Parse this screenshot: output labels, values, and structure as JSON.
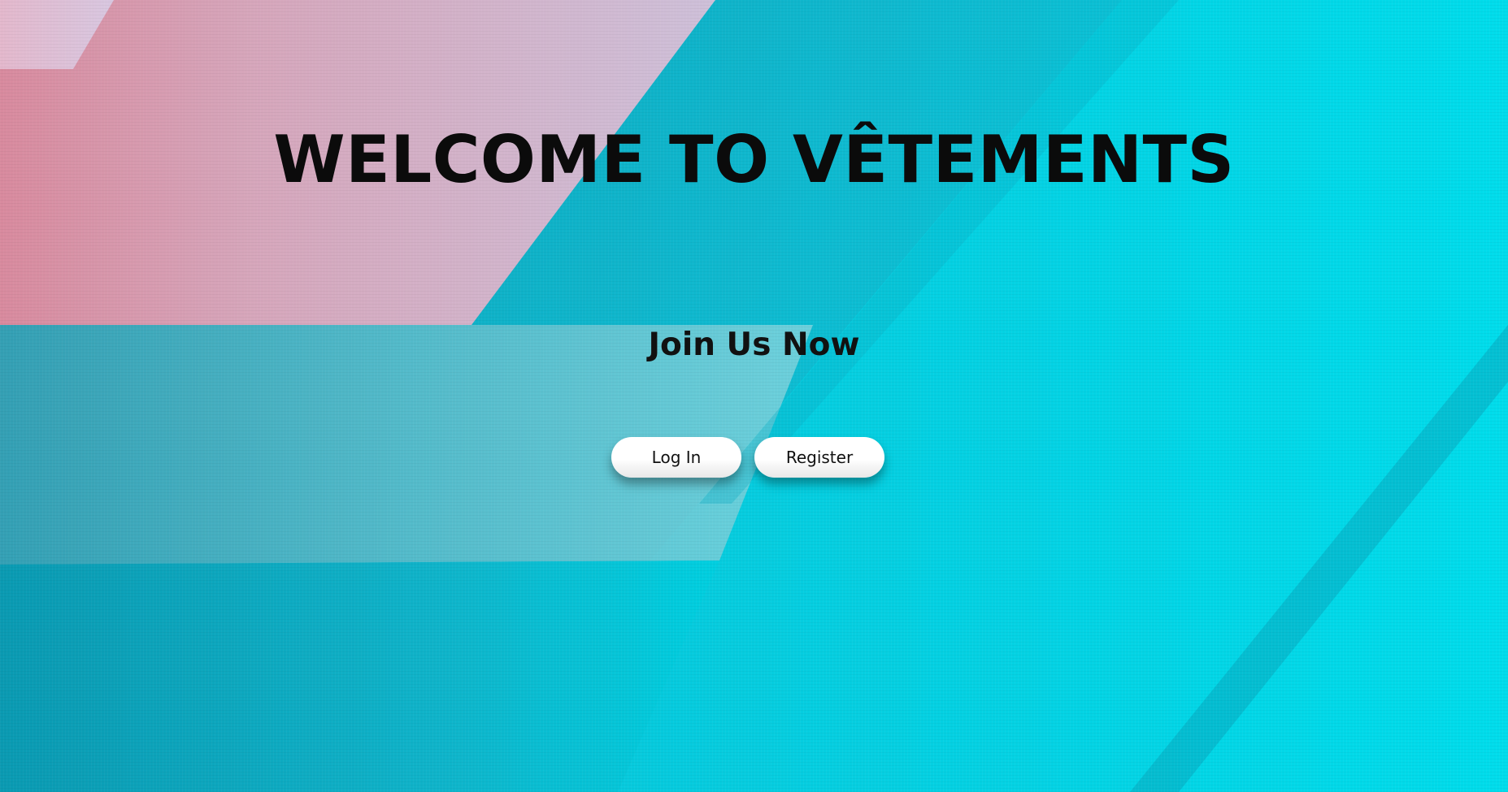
{
  "page": {
    "title": "WELCOME TO VÊTEMENTS",
    "subtitle": "Join Us Now"
  },
  "buttons": {
    "login_label": "Log In",
    "register_label": "Register"
  },
  "colors": {
    "background_teal": "#12b8cf",
    "background_cyan": "#00d8e6",
    "background_pink": "#d9a3b5",
    "background_lavender": "#cbbad8",
    "button_bg": "#ffffff",
    "text": "#0b0b0b"
  }
}
